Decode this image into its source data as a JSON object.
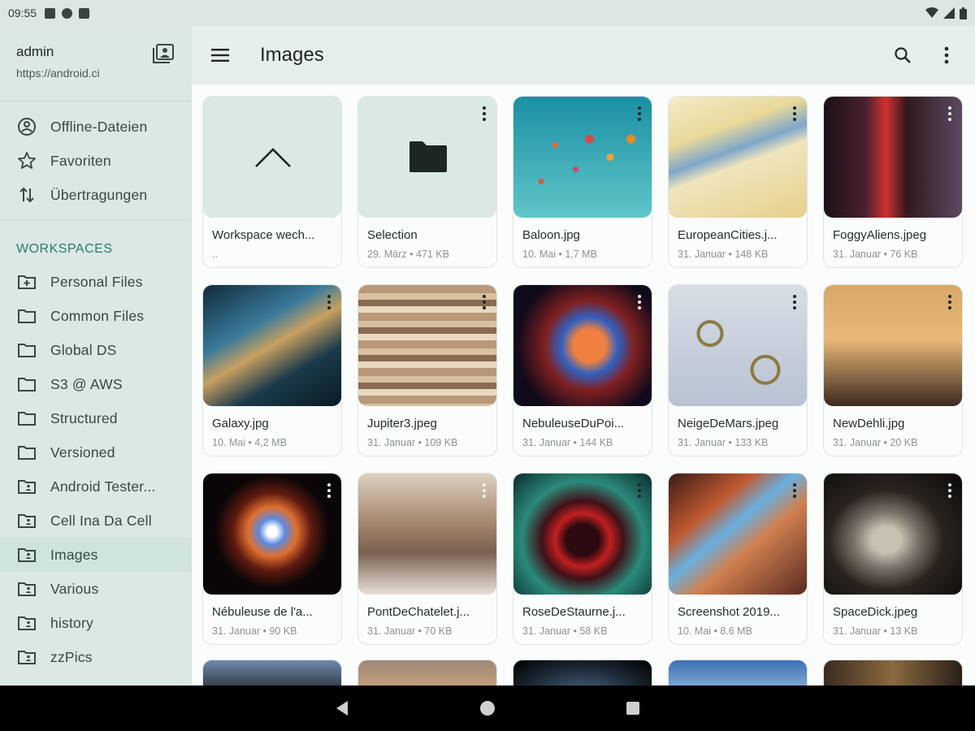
{
  "status_bar": {
    "time": "09:55"
  },
  "account": {
    "name": "admin",
    "url": "https://android.ci"
  },
  "nav_top": [
    {
      "label": "Offline-Dateien",
      "icon": "offline-icon"
    },
    {
      "label": "Favoriten",
      "icon": "star-icon"
    },
    {
      "label": "Übertragungen",
      "icon": "transfer-icon"
    }
  ],
  "workspaces_heading": "WORKSPACES",
  "workspaces": [
    {
      "label": "Personal Files",
      "icon": "folder-plus-icon"
    },
    {
      "label": "Common Files",
      "icon": "folder-icon"
    },
    {
      "label": "Global DS",
      "icon": "folder-icon"
    },
    {
      "label": "S3 @ AWS",
      "icon": "folder-icon"
    },
    {
      "label": "Structured",
      "icon": "folder-icon"
    },
    {
      "label": "Versioned",
      "icon": "folder-icon"
    },
    {
      "label": "Android Tester...",
      "icon": "folder-shared-icon"
    },
    {
      "label": "Cell Ina Da Cell",
      "icon": "folder-shared-icon"
    },
    {
      "label": "Images",
      "icon": "folder-shared-icon",
      "active": true
    },
    {
      "label": "Various",
      "icon": "folder-shared-icon"
    },
    {
      "label": "history",
      "icon": "folder-shared-icon"
    },
    {
      "label": "zzPics",
      "icon": "folder-shared-icon"
    }
  ],
  "appbar": {
    "title": "Images"
  },
  "files": [
    {
      "name": "Workspace wech...",
      "meta": "..",
      "kind": "parent"
    },
    {
      "name": "Selection",
      "meta": "29. März • 471 KB",
      "kind": "folder"
    },
    {
      "name": "Baloon.jpg",
      "meta": "10. Mai • 1,7 MB",
      "kind": "image"
    },
    {
      "name": "EuropeanCities.j...",
      "meta": "31. Januar • 148 KB",
      "kind": "image"
    },
    {
      "name": "FoggyAliens.jpeg",
      "meta": "31. Januar • 76 KB",
      "kind": "image"
    },
    {
      "name": "Galaxy.jpg",
      "meta": "10. Mai • 4,2 MB",
      "kind": "image"
    },
    {
      "name": "Jupiter3.jpeg",
      "meta": "31. Januar • 109 KB",
      "kind": "image"
    },
    {
      "name": "NebuleuseDuPoi...",
      "meta": "31. Januar • 144 KB",
      "kind": "image"
    },
    {
      "name": "NeigeDeMars.jpeg",
      "meta": "31. Januar • 133 KB",
      "kind": "image"
    },
    {
      "name": "NewDehli.jpg",
      "meta": "31. Januar • 20 KB",
      "kind": "image"
    },
    {
      "name": "Nébuleuse de l'a...",
      "meta": "31. Januar • 90 KB",
      "kind": "image"
    },
    {
      "name": "PontDeChatelet.j...",
      "meta": "31. Januar • 70 KB",
      "kind": "image"
    },
    {
      "name": "RoseDeStaurne.j...",
      "meta": "31. Januar • 58 KB",
      "kind": "image"
    },
    {
      "name": "Screenshot 2019...",
      "meta": "10. Mai • 8.6 MB",
      "kind": "image"
    },
    {
      "name": "SpaceDick.jpeg",
      "meta": "31. Januar • 13 KB",
      "kind": "image"
    }
  ],
  "colors": {
    "accent": "#5fe0d6",
    "section_heading": "#2f7a6c",
    "sidebar_bg": "#dbe8e4"
  }
}
